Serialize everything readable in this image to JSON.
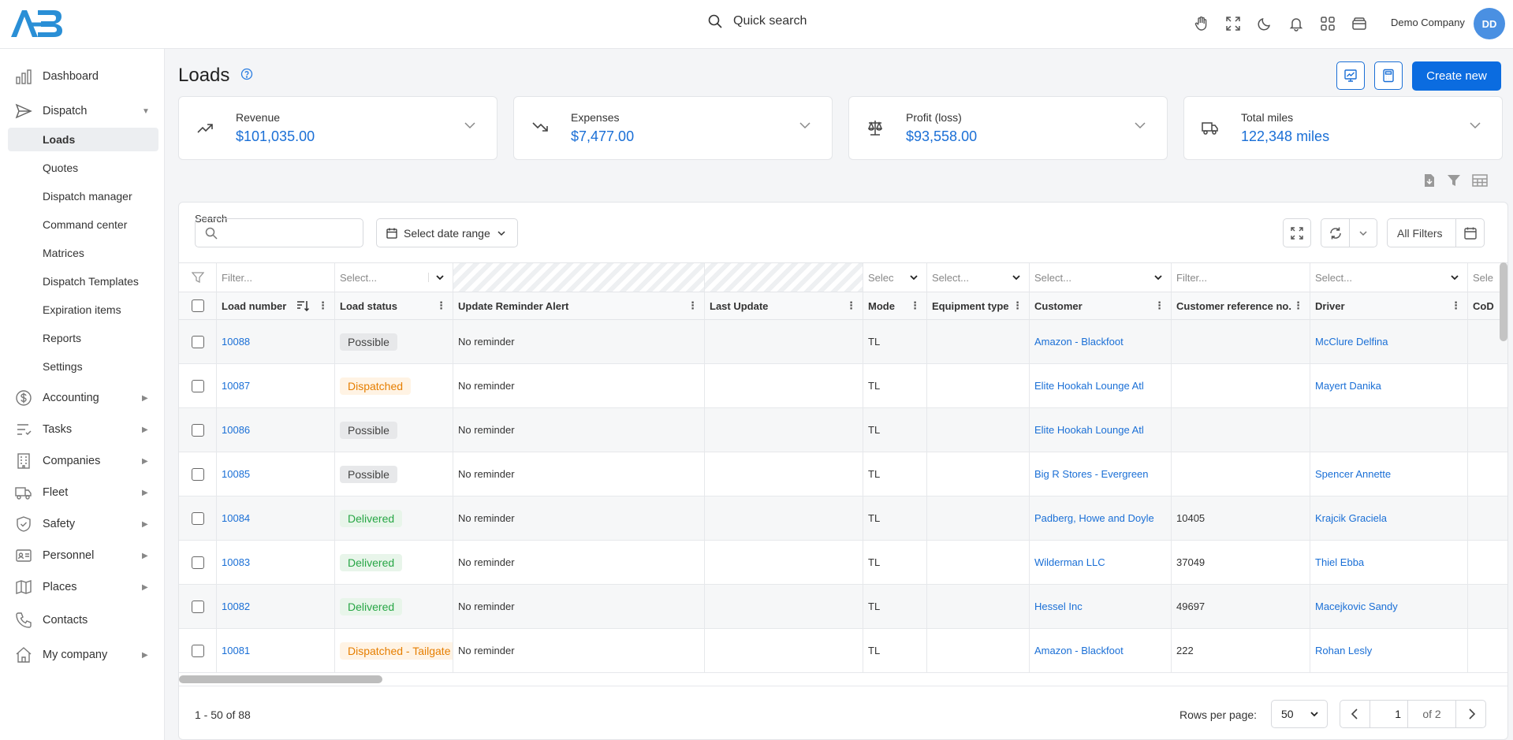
{
  "topbar": {
    "search_label": "Quick search",
    "company": "Demo Company",
    "avatar_initials": "DD",
    "icons": [
      "hand-icon",
      "fullscreen-icon",
      "moon-icon",
      "bell-icon",
      "apps-grid-icon",
      "wallet-icon"
    ]
  },
  "sidebar": {
    "dashboard": "Dashboard",
    "dispatch": "Dispatch",
    "dispatch_sub": [
      "Loads",
      "Quotes",
      "Dispatch manager",
      "Command center",
      "Matrices",
      "Dispatch Templates",
      "Expiration items",
      "Reports",
      "Settings"
    ],
    "accounting": "Accounting",
    "tasks": "Tasks",
    "companies": "Companies",
    "fleet": "Fleet",
    "safety": "Safety",
    "personnel": "Personnel",
    "places": "Places",
    "contacts": "Contacts",
    "my_company": "My company"
  },
  "page": {
    "title": "Loads",
    "create_label": "Create new"
  },
  "kpis": [
    {
      "title": "Revenue",
      "value": "$101,035.00",
      "icon": "trend-up-icon"
    },
    {
      "title": "Expenses",
      "value": "$7,477.00",
      "icon": "trend-down-icon"
    },
    {
      "title": "Profit (loss)",
      "value": "$93,558.00",
      "icon": "scale-icon"
    },
    {
      "title": "Total miles",
      "value": "122,348 miles",
      "icon": "truck-icon"
    }
  ],
  "toolbar": {
    "search_label": "Search",
    "search_value": "",
    "date_range": "Select date range",
    "all_filters": "All Filters"
  },
  "filters": {
    "load_number": "Filter...",
    "load_status": "Select...",
    "mode": "Selec",
    "equipment": "Select...",
    "customer": "Select...",
    "customer_ref": "Filter...",
    "driver": "Select...",
    "last": "Sele"
  },
  "columns": [
    "Load number",
    "Load status",
    "Update Reminder Alert",
    "Last Update",
    "Mode",
    "Equipment type",
    "Customer",
    "Customer reference no.",
    "Driver",
    "CoD"
  ],
  "rows": [
    {
      "load": "10088",
      "status": "Possible",
      "reminder": "No reminder",
      "update": "",
      "mode": "TL",
      "equipment": "",
      "customer": "Amazon - Blackfoot",
      "ref": "",
      "driver": "McClure Delfina"
    },
    {
      "load": "10087",
      "status": "Dispatched",
      "reminder": "No reminder",
      "update": "",
      "mode": "TL",
      "equipment": "",
      "customer": "Elite Hookah Lounge Atl",
      "ref": "",
      "driver": "Mayert Danika"
    },
    {
      "load": "10086",
      "status": "Possible",
      "reminder": "No reminder",
      "update": "",
      "mode": "TL",
      "equipment": "",
      "customer": "Elite Hookah Lounge Atl",
      "ref": "",
      "driver": ""
    },
    {
      "load": "10085",
      "status": "Possible",
      "reminder": "No reminder",
      "update": "",
      "mode": "TL",
      "equipment": "",
      "customer": "Big R Stores - Evergreen",
      "ref": "",
      "driver": "Spencer Annette"
    },
    {
      "load": "10084",
      "status": "Delivered",
      "reminder": "No reminder",
      "update": "",
      "mode": "TL",
      "equipment": "",
      "customer": "Padberg, Howe and Doyle",
      "ref": "10405",
      "driver": "Krajcik Graciela"
    },
    {
      "load": "10083",
      "status": "Delivered",
      "reminder": "No reminder",
      "update": "",
      "mode": "TL",
      "equipment": "",
      "customer": "Wilderman LLC",
      "ref": "37049",
      "driver": "Thiel Ebba"
    },
    {
      "load": "10082",
      "status": "Delivered",
      "reminder": "No reminder",
      "update": "",
      "mode": "TL",
      "equipment": "",
      "customer": "Hessel Inc",
      "ref": "49697",
      "driver": "Macejkovic Sandy"
    },
    {
      "load": "10081",
      "status": "Dispatched - Tailgate",
      "reminder": "No reminder",
      "update": "",
      "mode": "TL",
      "equipment": "",
      "customer": "Amazon - Blackfoot",
      "ref": "222",
      "driver": "Rohan Lesly"
    }
  ],
  "footer": {
    "range": "1 - 50 of 88",
    "rows_per_page_label": "Rows per page:",
    "rows_per_page": "50",
    "page": "1",
    "of_pages": "of 2"
  },
  "colors": {
    "accent": "#0b6ce0",
    "link": "#1a6fd6",
    "possible": "#444444",
    "dispatched": "#e67e00",
    "delivered": "#27a645"
  }
}
